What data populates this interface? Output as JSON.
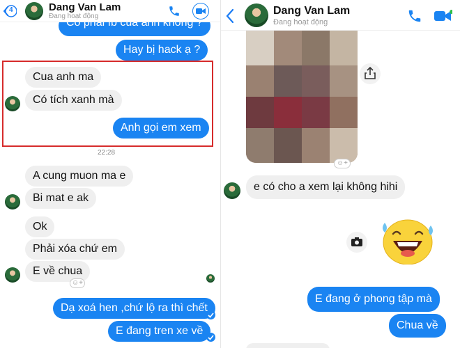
{
  "left": {
    "header": {
      "back_count": "4",
      "name": "Dang Van Lam",
      "status": "Đang hoạt động"
    },
    "messages": {
      "cut_off": "Có phải fb của anh không ?",
      "hack": "Hay bị hack ạ ?",
      "cua_anh_ma": "Cua anh ma",
      "co_tich_xanh": "Có tích xanh mà",
      "anh_goi": "Anh gọi em xem",
      "time": "22:28",
      "a_cung_muon": "A cung muon ma e",
      "bi_mat": "Bi mat e ak",
      "ok": "Ok",
      "phai_xoa": "Phải xóa chứ em",
      "e_ve_chua": "E về chua",
      "da_xoa": "Dạ xoá hen ,chứ lộ ra thì chết",
      "e_dang_tren": "E đang tren xe về"
    }
  },
  "right": {
    "header": {
      "name": "Dang Van Lam",
      "status": "Đang hoạt động"
    },
    "messages": {
      "e_co_cho": "e có cho a xem lại không hihi",
      "e_dang_o": "E đang ở phong tập mà",
      "chua_ve": "Chua về"
    }
  },
  "colors": {
    "accent": "#1a84f2",
    "incoming": "#efefef",
    "highlight": "#d62b2b",
    "call_green": "#2fbf4a"
  },
  "icons": [
    "back-chevron-icon",
    "phone-icon",
    "video-camera-icon",
    "share-icon",
    "camera-icon",
    "add-reaction-icon",
    "sent-check-icon",
    "laughing-emoji"
  ]
}
